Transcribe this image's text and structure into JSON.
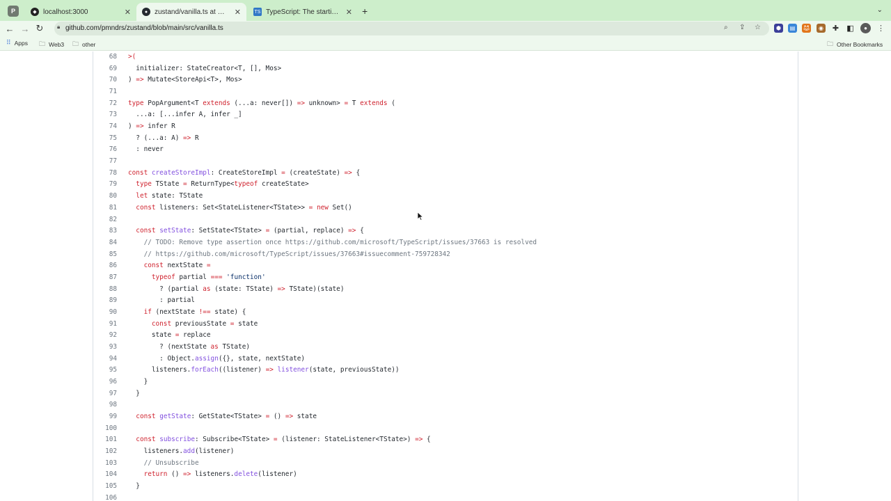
{
  "browser": {
    "tabs": [
      {
        "title": "localhost:3000",
        "favicon": "react-icon",
        "active": false
      },
      {
        "title": "zustand/vanilla.ts at main · pm",
        "favicon": "github-icon",
        "active": true
      },
      {
        "title": "TypeScript: The starting point",
        "favicon": "typescript-icon",
        "active": false
      }
    ],
    "profile_badge": "P",
    "new_tab_glyph": "+",
    "ts_badge": "TS",
    "url": "github.com/pmndrs/zustand/blob/main/src/vanilla.ts"
  },
  "bookmarks": {
    "items": [
      "Apps",
      "Web3",
      "other"
    ],
    "other_bookmarks": "Other Bookmarks"
  },
  "code": {
    "lines": [
      {
        "n": "68",
        "indent": 0,
        "tokens": [
          [
            ">(",
            "k"
          ]
        ]
      },
      {
        "n": "69",
        "indent": 2,
        "tokens": [
          [
            "initializer: StateCreator<T, [], Mos>",
            ""
          ]
        ]
      },
      {
        "n": "70",
        "indent": 0,
        "tokens": [
          [
            ") ",
            ""
          ],
          [
            "=>",
            "k"
          ],
          [
            " Mutate<StoreApi<T>, Mos>",
            ""
          ]
        ]
      },
      {
        "n": "71",
        "indent": 0,
        "tokens": []
      },
      {
        "n": "72",
        "indent": 0,
        "tokens": [
          [
            "type",
            "k"
          ],
          [
            " PopArgument<T ",
            ""
          ],
          [
            "extends",
            "k"
          ],
          [
            " (...a: never[]) ",
            ""
          ],
          [
            "=>",
            "k"
          ],
          [
            " unknown> ",
            ""
          ],
          [
            "=",
            "k"
          ],
          [
            " T ",
            ""
          ],
          [
            "extends",
            "k"
          ],
          [
            " (",
            ""
          ]
        ]
      },
      {
        "n": "73",
        "indent": 2,
        "tokens": [
          [
            "...a: [...infer A, infer _]",
            ""
          ]
        ]
      },
      {
        "n": "74",
        "indent": 0,
        "tokens": [
          [
            ") ",
            ""
          ],
          [
            "=>",
            "k"
          ],
          [
            " infer R",
            ""
          ]
        ]
      },
      {
        "n": "75",
        "indent": 2,
        "tokens": [
          [
            "? (...a: A) ",
            ""
          ],
          [
            "=>",
            "k"
          ],
          [
            " R",
            ""
          ]
        ]
      },
      {
        "n": "76",
        "indent": 2,
        "tokens": [
          [
            ": never",
            ""
          ]
        ]
      },
      {
        "n": "77",
        "indent": 0,
        "tokens": []
      },
      {
        "n": "78",
        "indent": 0,
        "tokens": [
          [
            "const",
            "k"
          ],
          [
            " ",
            ""
          ],
          [
            "createStoreImpl",
            "f"
          ],
          [
            ": CreateStoreImpl ",
            ""
          ],
          [
            "=",
            "k"
          ],
          [
            " (createState) ",
            ""
          ],
          [
            "=>",
            "k"
          ],
          [
            " {",
            ""
          ]
        ]
      },
      {
        "n": "79",
        "indent": 2,
        "tokens": [
          [
            "type",
            "k"
          ],
          [
            " TState ",
            ""
          ],
          [
            "=",
            "k"
          ],
          [
            " ReturnType<",
            ""
          ],
          [
            "typeof",
            "k"
          ],
          [
            " createState>",
            ""
          ]
        ]
      },
      {
        "n": "80",
        "indent": 2,
        "tokens": [
          [
            "let",
            "k"
          ],
          [
            " state: TState",
            ""
          ]
        ]
      },
      {
        "n": "81",
        "indent": 2,
        "tokens": [
          [
            "const",
            "k"
          ],
          [
            " listeners: Set<StateListener<TState>> ",
            ""
          ],
          [
            "=",
            "k"
          ],
          [
            " ",
            ""
          ],
          [
            "new",
            "k"
          ],
          [
            " Set()",
            ""
          ]
        ]
      },
      {
        "n": "82",
        "indent": 0,
        "tokens": []
      },
      {
        "n": "83",
        "indent": 2,
        "tokens": [
          [
            "const",
            "k"
          ],
          [
            " ",
            ""
          ],
          [
            "setState",
            "f"
          ],
          [
            ": SetState<TState> ",
            ""
          ],
          [
            "=",
            "k"
          ],
          [
            " (partial, replace) ",
            ""
          ],
          [
            "=>",
            "k"
          ],
          [
            " {",
            ""
          ]
        ]
      },
      {
        "n": "84",
        "indent": 4,
        "tokens": [
          [
            "// TODO: Remove type assertion once https://github.com/microsoft/TypeScript/issues/37663 is resolved",
            "c"
          ]
        ]
      },
      {
        "n": "85",
        "indent": 4,
        "tokens": [
          [
            "// https://github.com/microsoft/TypeScript/issues/37663#issuecomment-759728342",
            "c"
          ]
        ]
      },
      {
        "n": "86",
        "indent": 4,
        "tokens": [
          [
            "const",
            "k"
          ],
          [
            " nextState ",
            ""
          ],
          [
            "=",
            "k"
          ]
        ]
      },
      {
        "n": "87",
        "indent": 6,
        "tokens": [
          [
            "typeof",
            "k"
          ],
          [
            " partial ",
            ""
          ],
          [
            "===",
            "k"
          ],
          [
            " ",
            ""
          ],
          [
            "'function'",
            "s"
          ]
        ]
      },
      {
        "n": "88",
        "indent": 8,
        "tokens": [
          [
            "? (partial ",
            ""
          ],
          [
            "as",
            "k"
          ],
          [
            " (state: TState) ",
            ""
          ],
          [
            "=>",
            "k"
          ],
          [
            " TState)(state)",
            ""
          ]
        ]
      },
      {
        "n": "89",
        "indent": 8,
        "tokens": [
          [
            ": partial",
            ""
          ]
        ]
      },
      {
        "n": "90",
        "indent": 4,
        "tokens": [
          [
            "if",
            "k"
          ],
          [
            " (nextState ",
            ""
          ],
          [
            "!==",
            "k"
          ],
          [
            " state) {",
            ""
          ]
        ]
      },
      {
        "n": "91",
        "indent": 6,
        "tokens": [
          [
            "const",
            "k"
          ],
          [
            " previousState ",
            ""
          ],
          [
            "=",
            "k"
          ],
          [
            " state",
            ""
          ]
        ]
      },
      {
        "n": "92",
        "indent": 6,
        "tokens": [
          [
            "state ",
            ""
          ],
          [
            "=",
            "k"
          ],
          [
            " replace",
            ""
          ]
        ]
      },
      {
        "n": "93",
        "indent": 8,
        "tokens": [
          [
            "? (nextState ",
            ""
          ],
          [
            "as",
            "k"
          ],
          [
            " TState)",
            ""
          ]
        ]
      },
      {
        "n": "94",
        "indent": 8,
        "tokens": [
          [
            ": Object.",
            ""
          ],
          [
            "assign",
            "f"
          ],
          [
            "({}, state, nextState)",
            ""
          ]
        ]
      },
      {
        "n": "95",
        "indent": 6,
        "tokens": [
          [
            "listeners.",
            ""
          ],
          [
            "forEach",
            "f"
          ],
          [
            "((listener) ",
            ""
          ],
          [
            "=>",
            "k"
          ],
          [
            " ",
            ""
          ],
          [
            "listener",
            "f"
          ],
          [
            "(state, previousState))",
            ""
          ]
        ]
      },
      {
        "n": "96",
        "indent": 4,
        "tokens": [
          [
            "}",
            ""
          ]
        ]
      },
      {
        "n": "97",
        "indent": 2,
        "tokens": [
          [
            "}",
            ""
          ]
        ]
      },
      {
        "n": "98",
        "indent": 0,
        "tokens": []
      },
      {
        "n": "99",
        "indent": 2,
        "tokens": [
          [
            "const",
            "k"
          ],
          [
            " ",
            ""
          ],
          [
            "getState",
            "f"
          ],
          [
            ": GetState<TState> ",
            ""
          ],
          [
            "=",
            "k"
          ],
          [
            " () ",
            ""
          ],
          [
            "=>",
            "k"
          ],
          [
            " state",
            ""
          ]
        ]
      },
      {
        "n": "100",
        "indent": 0,
        "tokens": []
      },
      {
        "n": "101",
        "indent": 2,
        "tokens": [
          [
            "const",
            "k"
          ],
          [
            " ",
            ""
          ],
          [
            "subscribe",
            "f"
          ],
          [
            ": Subscribe<TState> ",
            ""
          ],
          [
            "=",
            "k"
          ],
          [
            " (listener: StateListener<TState>) ",
            ""
          ],
          [
            "=>",
            "k"
          ],
          [
            " {",
            ""
          ]
        ]
      },
      {
        "n": "102",
        "indent": 4,
        "tokens": [
          [
            "listeners.",
            ""
          ],
          [
            "add",
            "f"
          ],
          [
            "(listener)",
            ""
          ]
        ]
      },
      {
        "n": "103",
        "indent": 4,
        "tokens": [
          [
            "// Unsubscribe",
            "c"
          ]
        ]
      },
      {
        "n": "104",
        "indent": 4,
        "tokens": [
          [
            "return",
            "k"
          ],
          [
            " () ",
            ""
          ],
          [
            "=>",
            "k"
          ],
          [
            " listeners.",
            ""
          ],
          [
            "delete",
            "f"
          ],
          [
            "(listener)",
            ""
          ]
        ]
      },
      {
        "n": "105",
        "indent": 2,
        "tokens": [
          [
            "}",
            ""
          ]
        ]
      },
      {
        "n": "106",
        "indent": 0,
        "tokens": []
      }
    ]
  },
  "colors": {
    "tabstrip": "#cdeecb",
    "toolbar": "#eef8ee",
    "keyword": "#cf222e",
    "function": "#8250df",
    "string": "#0a3069",
    "comment": "#6e7781"
  }
}
